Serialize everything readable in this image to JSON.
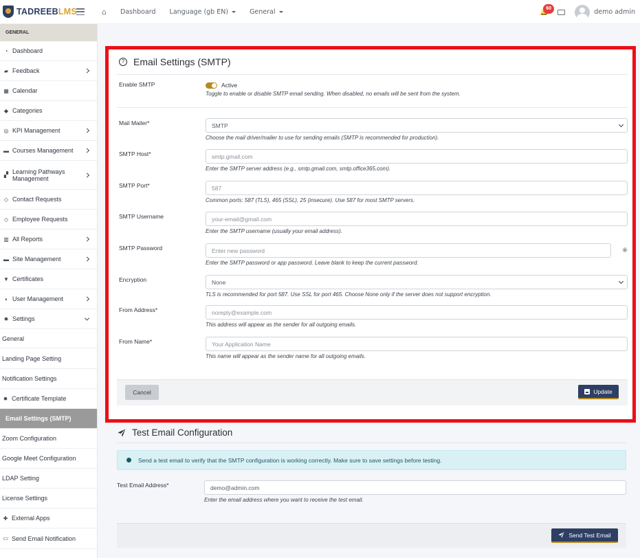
{
  "brand": {
    "name_part1": "TADREEB",
    "name_part2": "LMS"
  },
  "topnav": {
    "dashboard": "Dashboard",
    "language": "Language (‫gb‬ EN)",
    "general": "General"
  },
  "topbar": {
    "notification_count": "60",
    "user_name": "demo admin"
  },
  "sidebar": {
    "section": "GENERAL",
    "items": [
      {
        "label": "Dashboard",
        "icon": "gauge-icon",
        "chevron": ""
      },
      {
        "label": "Feedback",
        "icon": "comments-icon",
        "chevron": "right"
      },
      {
        "label": "Calendar",
        "icon": "calendar-icon",
        "chevron": ""
      },
      {
        "label": "Categories",
        "icon": "tags-icon",
        "chevron": ""
      },
      {
        "label": "KPI Management",
        "icon": "target-icon",
        "chevron": "right"
      },
      {
        "label": "Courses Management",
        "icon": "book-icon",
        "chevron": "right"
      },
      {
        "label": "Learning Pathways Management",
        "icon": "sitemap-icon",
        "chevron": "right"
      },
      {
        "label": "Contact Requests",
        "icon": "tag-icon",
        "chevron": ""
      },
      {
        "label": "Employee Requests",
        "icon": "tag-icon",
        "chevron": ""
      },
      {
        "label": "All Reports",
        "icon": "chart-icon",
        "chevron": "right"
      },
      {
        "label": "Site Management",
        "icon": "folder-icon",
        "chevron": "right"
      },
      {
        "label": "Certificates",
        "icon": "trophy-icon",
        "chevron": ""
      },
      {
        "label": "User Management",
        "icon": "shield-icon",
        "chevron": "right"
      },
      {
        "label": "Settings",
        "icon": "gear-icon",
        "chevron": "down"
      }
    ],
    "sub_items": [
      {
        "label": "General",
        "icon": ""
      },
      {
        "label": "Landing Page Setting",
        "icon": ""
      },
      {
        "label": "Notification Settings",
        "icon": ""
      },
      {
        "label": "Certificate Template",
        "icon": "gear-icon"
      },
      {
        "label": "Email Settings (SMTP)",
        "icon": "",
        "active": true
      },
      {
        "label": "Zoom Configuration",
        "icon": ""
      },
      {
        "label": "Google Meet Configuration",
        "icon": ""
      },
      {
        "label": "LDAP Setting",
        "icon": ""
      },
      {
        "label": "License Settings",
        "icon": ""
      },
      {
        "label": "External Apps",
        "icon": "puzzle-icon"
      },
      {
        "label": "Send Email Notification",
        "icon": "envelope-icon"
      }
    ]
  },
  "smtp": {
    "title": "Email Settings (SMTP)",
    "enable": {
      "label": "Enable SMTP",
      "state_label": "Active",
      "help": "Toggle to enable or disable SMTP email sending. When disabled, no emails will be sent from the system."
    },
    "mailer": {
      "label": "Mail Mailer*",
      "value": "SMTP",
      "help": "Choose the mail driver/mailer to use for sending emails (SMTP is recommended for production)."
    },
    "host": {
      "label": "SMTP Host*",
      "placeholder": "smtp.gmail.com",
      "help": "Enter the SMTP server address (e.g., smtp.gmail.com, smtp.office365.com)."
    },
    "port": {
      "label": "SMTP Port*",
      "placeholder": "587",
      "help": "Common ports: 587 (TLS), 465 (SSL), 25 (insecure). Use 587 for most SMTP servers."
    },
    "username": {
      "label": "SMTP Username",
      "placeholder": "your-email@gmail.com",
      "help": "Enter the SMTP username (usually your email address)."
    },
    "password": {
      "label": "SMTP Password",
      "placeholder": "Enter new password",
      "help": "Enter the SMTP password or app password. Leave blank to keep the current password."
    },
    "encryption": {
      "label": "Encryption",
      "value": "None",
      "help": "TLS is recommended for port 587. Use SSL for port 465. Choose None only if the server does not support encryption."
    },
    "from_address": {
      "label": "From Address*",
      "placeholder": "noreply@example.com",
      "help": "This address will appear as the sender for all outgoing emails."
    },
    "from_name": {
      "label": "From Name*",
      "placeholder": "Your Application Name",
      "help": "This name will appear as the sender name for all outgoing emails."
    },
    "cancel_label": "Cancel",
    "update_label": "Update"
  },
  "test": {
    "title": "Test Email Configuration",
    "info": "Send a test email to verify that the SMTP configuration is working correctly. Make sure to save settings before testing.",
    "address": {
      "label": "Test Email Address*",
      "value": "demo@admin.com",
      "help": "Enter the email address where you want to receive the test email."
    },
    "send_label": "Send Test Email"
  },
  "colors": {
    "highlight_border": "#ec0f16",
    "accent": "#b58a1e",
    "primary": "#2e3f63"
  }
}
